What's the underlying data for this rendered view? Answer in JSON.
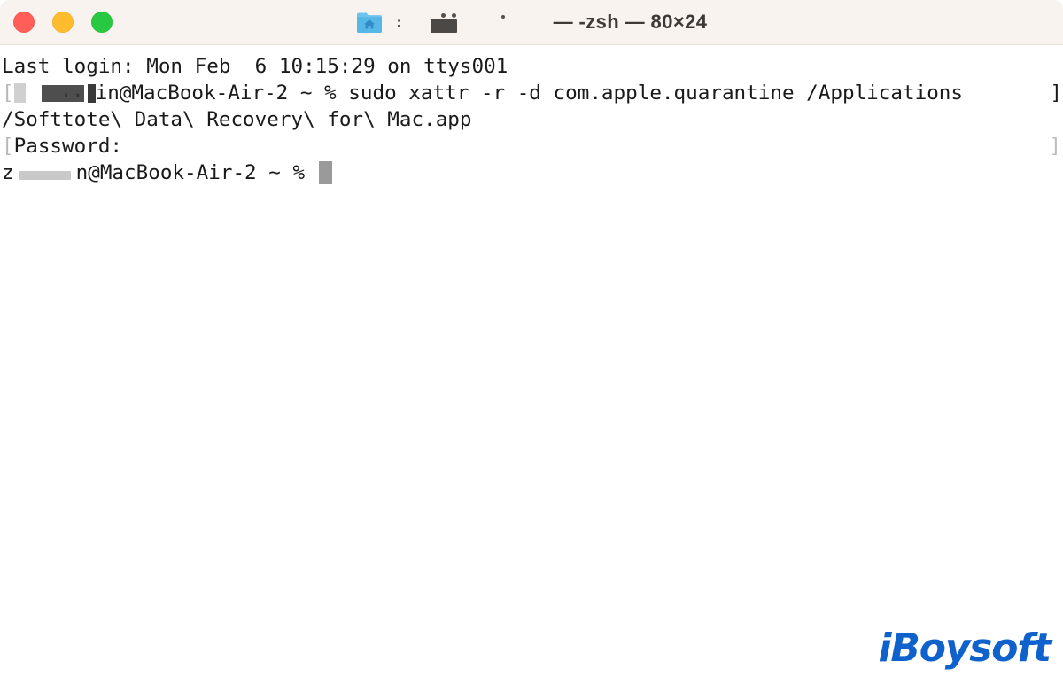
{
  "window": {
    "titlebar": {
      "traffic_lights": [
        {
          "name": "close",
          "color": "#ff5f57"
        },
        {
          "name": "minimize",
          "color": "#febc2e"
        },
        {
          "name": "maximize",
          "color": "#28c840"
        }
      ],
      "folder_icon": "home-folder-icon",
      "redacted_username": "",
      "title": "— -zsh — 80×24",
      "shell": "-zsh",
      "size": "80×24",
      "background": "#f8f3ee"
    },
    "terminal": {
      "background": "#ffffff",
      "text_color": "#1a1a1a",
      "cursor_color": "#9a9a9a",
      "lines": {
        "line1": "Last login: Mon Feb  6 10:15:29 on ttys001",
        "line2_prompt_suffix": "in@MacBook-Air-2 ~ % ",
        "line2_command": "sudo xattr -r -d com.apple.quarantine /Applications",
        "line3": "/Softtote\\ Data\\ Recovery\\ for\\ Mac.app",
        "line4": "Password:",
        "line5_prompt_start": "z",
        "line5_prompt_suffix": "n@MacBook-Air-2 ~ % ",
        "open_bracket": "[",
        "close_bracket": "]"
      }
    },
    "watermark": {
      "text": "iBoysoft",
      "color": "#0f62cc"
    }
  }
}
